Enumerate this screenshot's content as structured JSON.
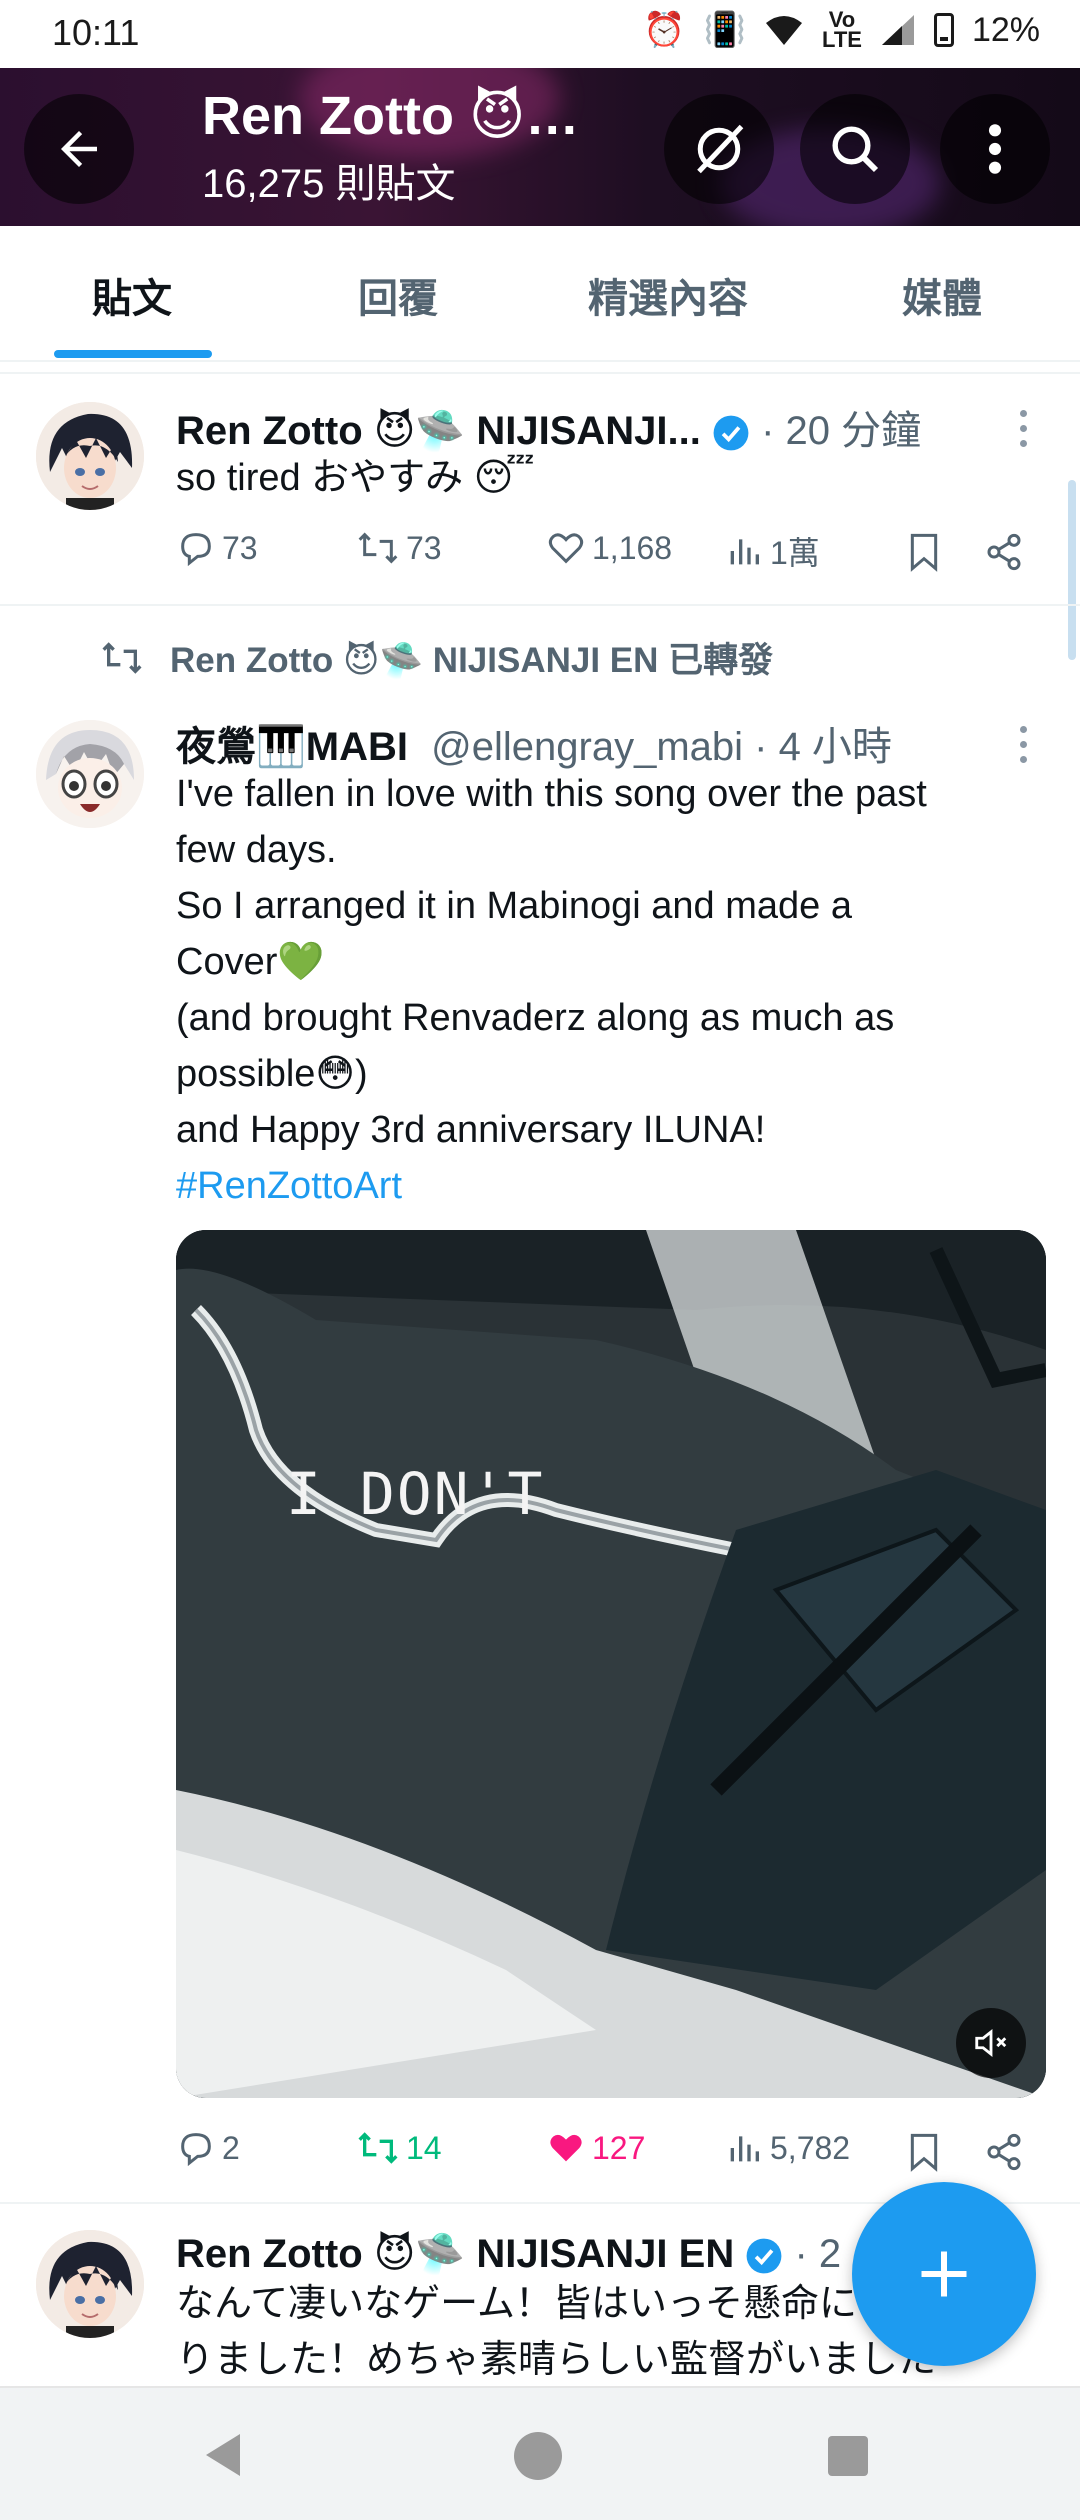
{
  "status_bar": {
    "time": "10:11",
    "battery": "12%"
  },
  "header": {
    "title": "Ren Zotto 😈…",
    "post_count": "16,275 則貼文"
  },
  "tabs": [
    {
      "label": "貼文"
    },
    {
      "label": "回覆"
    },
    {
      "label": "精選內容"
    },
    {
      "label": "媒體"
    }
  ],
  "tweet1": {
    "name": "Ren Zotto 😈🛸 NIJISANJI...",
    "meta": "· 20 分鐘",
    "text": "so tired おやすみ 😴",
    "replies": "73",
    "retweets": "73",
    "likes": "1,168",
    "views": "1萬"
  },
  "retweet_banner": "Ren Zotto 😈🛸 NIJISANJI EN 已轉發",
  "tweet2": {
    "name": "夜鶯🎹MABI",
    "handle": "@ellengray_mabi · 4 小時",
    "lines": [
      "I've fallen in love with this song over the past",
      "few days.",
      "So I arranged it in Mabinogi and made a",
      "Cover💚",
      "(and brought Renvaderz along as much as",
      "possible😳)",
      "and Happy 3rd anniversary ILUNA!"
    ],
    "hashtag": "#RenZottoArt",
    "media_caption": "I DON'T",
    "replies": "2",
    "retweets": "14",
    "likes": "127",
    "views": "5,782"
  },
  "tweet3": {
    "name": "Ren Zotto 😈🛸 NIJISANJI EN",
    "meta": "· 2",
    "line1": "なんて凄いなゲーム！皆はいっそ懸命に",
    "line2": "りました！めちゃ素晴らしい監督がいました"
  },
  "colors": {
    "accent": "#1d9bf0",
    "like": "#f91880",
    "retweet": "#00ba7c",
    "muted": "#536471"
  }
}
